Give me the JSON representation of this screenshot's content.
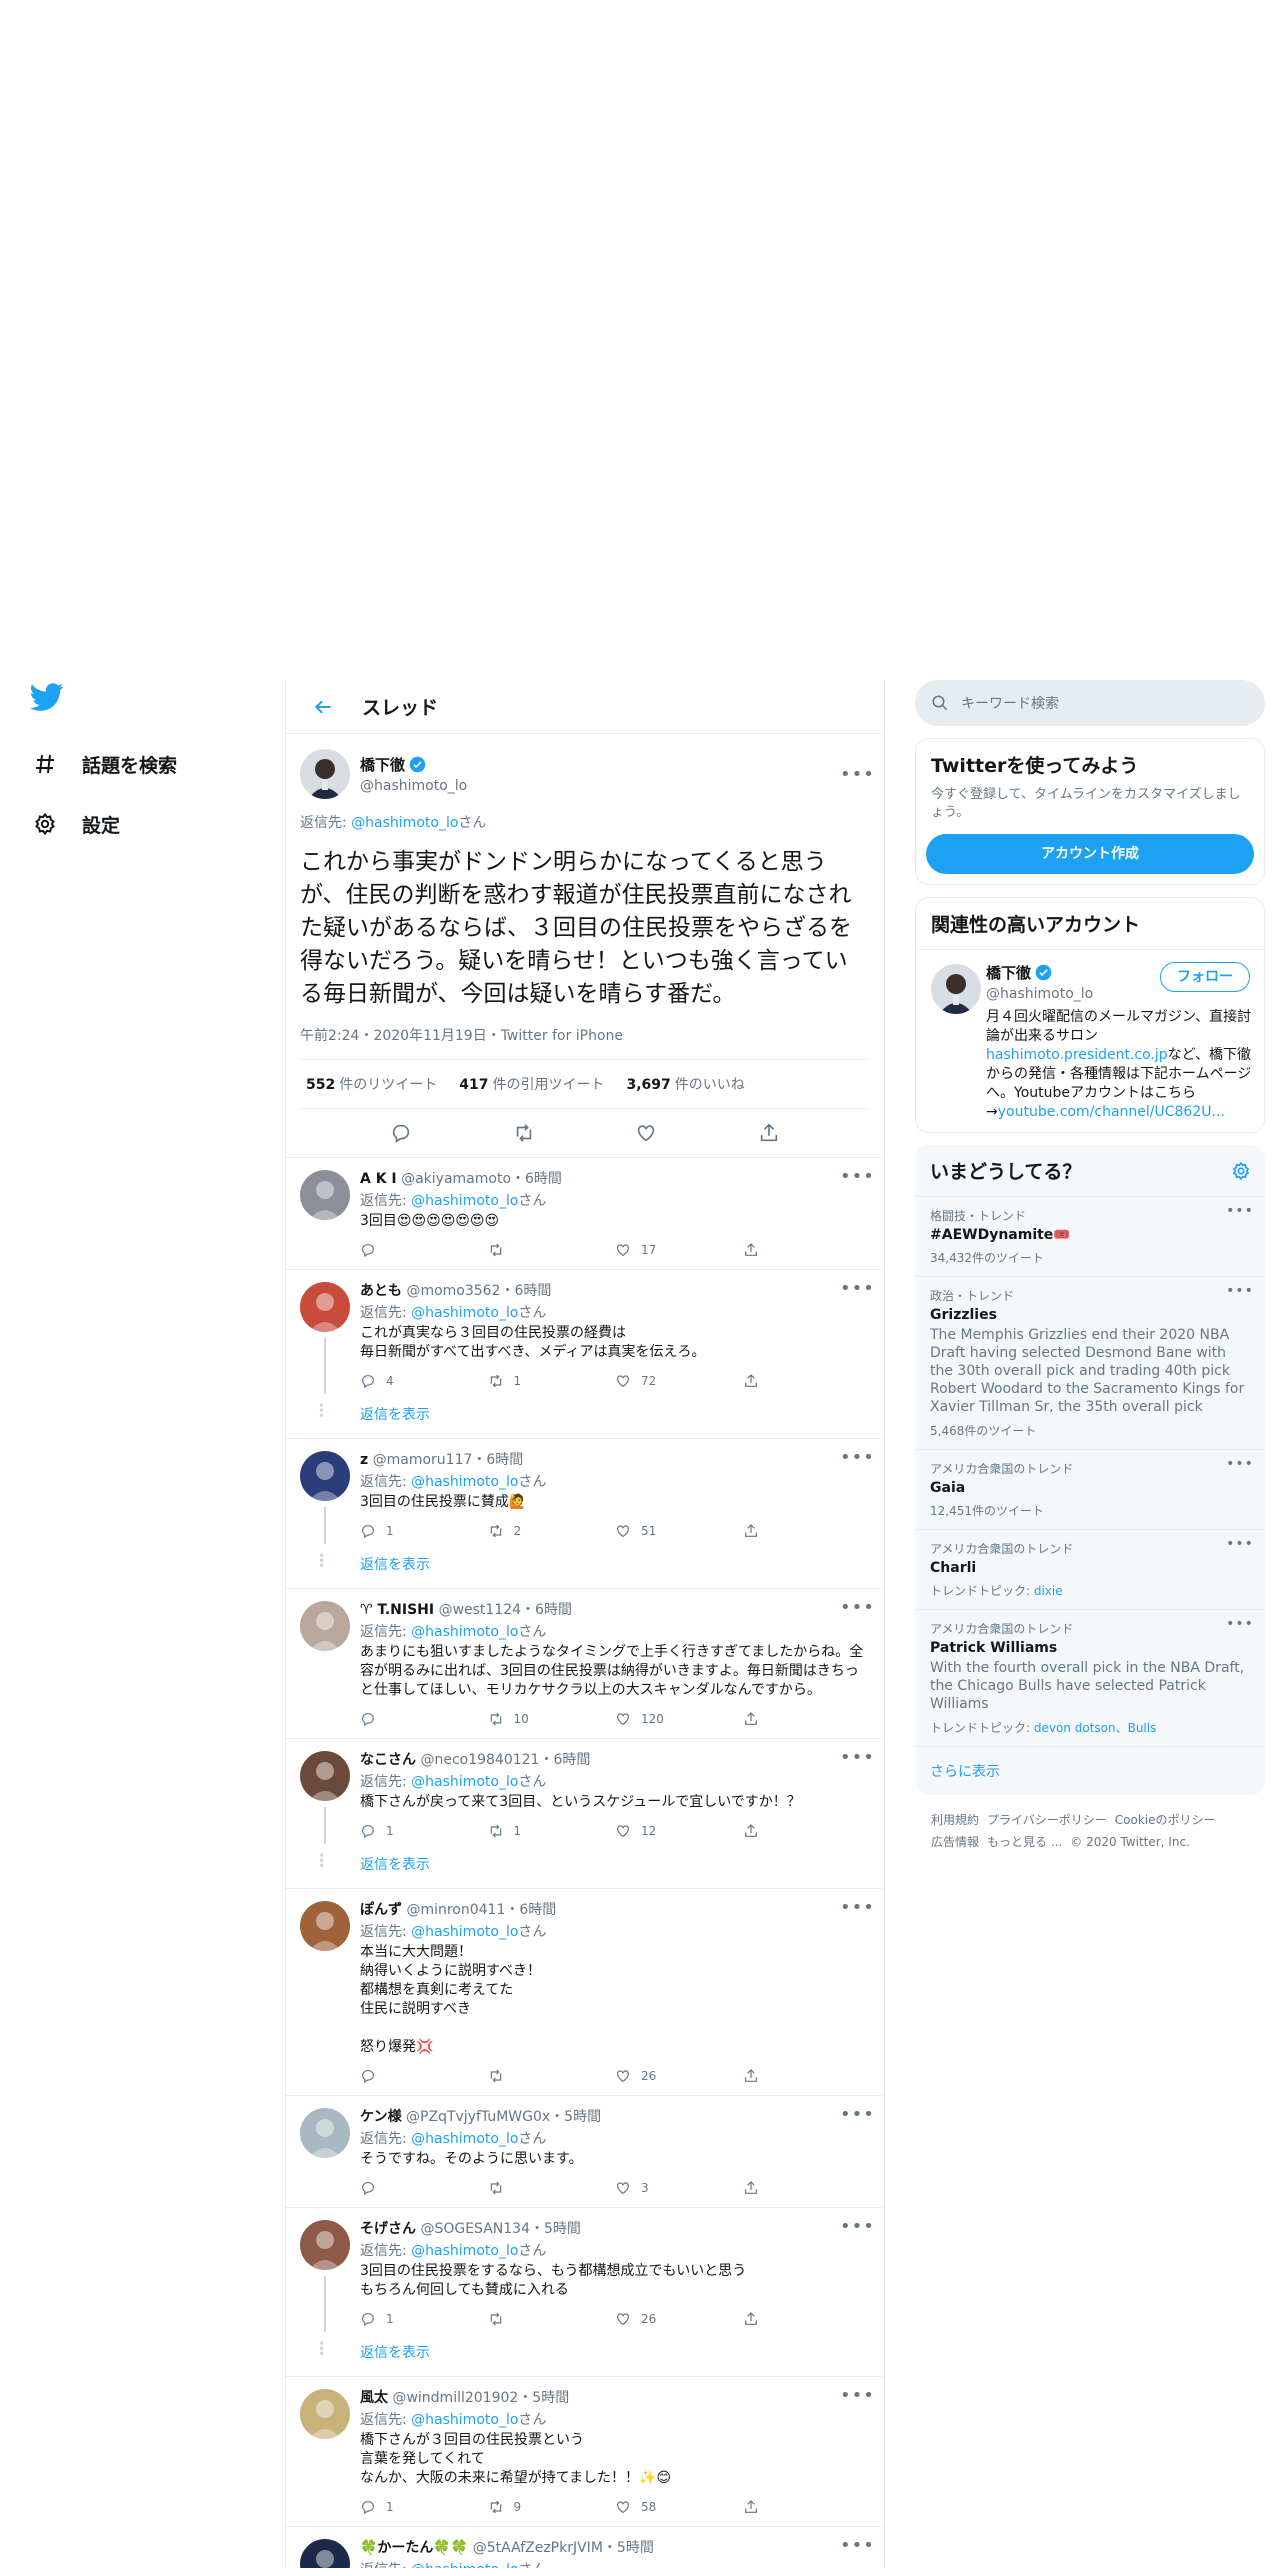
{
  "nav": {
    "items": [
      {
        "label": "話題を検索",
        "icon": "hashtag-icon"
      },
      {
        "label": "設定",
        "icon": "gear-icon"
      }
    ]
  },
  "header": {
    "title": "スレッド"
  },
  "focus": {
    "name": "橋下徹",
    "handle": "@hashimoto_lo",
    "reply_prefix": "返信先: ",
    "reply_to": "@hashimoto_lo",
    "reply_suffix": "さん",
    "text": "これから事実がドンドン明らかになってくると思うが、住民の判断を惑わす報道が住民投票直前になされた疑いがあるならば、３回目の住民投票をやらざるを得ないだろう。疑いを晴らせ！といつも強く言っている毎日新聞が、今回は疑いを晴らす番だ。",
    "meta": "午前2:24・2020年11月19日・Twitter for iPhone",
    "retweets": "552",
    "retweets_label": "件のリツイート",
    "quotes": "417",
    "quotes_label": "件の引用ツイート",
    "likes": "3,697",
    "likes_label": "件のいいね"
  },
  "replies": [
    {
      "name": "A K I",
      "handle": "@akiyamamoto",
      "time": "・6時間",
      "reply_to": "@hashimoto_lo",
      "text": "3回目😍😍😍😍😍😍😍",
      "replies": "",
      "retweets": "",
      "likes": "17",
      "show_replies": "",
      "avatar_color": "#8a8f99"
    },
    {
      "name": "あとも",
      "handle": "@momo3562",
      "time": "・6時間",
      "reply_to": "@hashimoto_lo",
      "text": "これが真実なら３回目の住民投票の経費は\n毎日新聞がすべて出すべき、メディアは真実を伝えろ。",
      "replies": "4",
      "retweets": "1",
      "likes": "72",
      "show_replies": "返信を表示",
      "avatar_color": "#c84b3c"
    },
    {
      "name": "z",
      "handle": "@mamoru117",
      "time": "・6時間",
      "reply_to": "@hashimoto_lo",
      "text": "3回目の住民投票に賛成🙋",
      "replies": "1",
      "retweets": "2",
      "likes": "51",
      "show_replies": "返信を表示",
      "avatar_color": "#2a3d7a"
    },
    {
      "name": "♈ T.NISHI",
      "handle": "@west1124",
      "time": "・6時間",
      "reply_to": "@hashimoto_lo",
      "text": "あまりにも狙いすましたようなタイミングで上手く行きすぎてましたからね。全容が明るみに出れば、3回目の住民投票は納得がいきますよ。毎日新聞はきちっと仕事してほしい、モリカケサクラ以上の大スキャンダルなんですから。",
      "replies": "",
      "retweets": "10",
      "likes": "120",
      "show_replies": "",
      "avatar_color": "#b8a79a"
    },
    {
      "name": "なこさん",
      "handle": "@neco19840121",
      "time": "・6時間",
      "reply_to": "@hashimoto_lo",
      "text": "橋下さんが戻って来て3回目、というスケジュールで宜しいですか！？",
      "replies": "1",
      "retweets": "1",
      "likes": "12",
      "show_replies": "返信を表示",
      "avatar_color": "#6b4a3a"
    },
    {
      "name": "ぽんず",
      "handle": "@minron0411",
      "time": "・6時間",
      "reply_to": "@hashimoto_lo",
      "text": "本当に大大問題！\n納得いくように説明すべき！\n都構想を真剣に考えてた\n住民に説明すべき\n\n怒り爆発💢",
      "replies": "",
      "retweets": "",
      "likes": "26",
      "show_replies": "",
      "avatar_color": "#a0623a"
    },
    {
      "name": "ケン様",
      "handle": "@PZqTvjyfTuMWG0x",
      "time": "・5時間",
      "reply_to": "@hashimoto_lo",
      "text": "そうですね。そのように思います。",
      "replies": "",
      "retweets": "",
      "likes": "3",
      "show_replies": "",
      "avatar_color": "#aab8c2"
    },
    {
      "name": "そげさん",
      "handle": "@SOGESAN134",
      "time": "・5時間",
      "reply_to": "@hashimoto_lo",
      "text": "3回目の住民投票をするなら、もう都構想成立でもいいと思う\nもちろん何回しても賛成に入れる",
      "replies": "1",
      "retweets": "",
      "likes": "26",
      "show_replies": "返信を表示",
      "avatar_color": "#8c5a46"
    },
    {
      "name": "風太",
      "handle": "@windmill201902",
      "time": "・5時間",
      "reply_to": "@hashimoto_lo",
      "text": "橋下さんが３回目の住民投票という\n言葉を発してくれて\nなんか、大阪の未来に希望が持てました！！✨😊",
      "replies": "1",
      "retweets": "9",
      "likes": "58",
      "show_replies": "",
      "avatar_color": "#c9b17a"
    },
    {
      "name": "🍀かーたん🍀🍀",
      "handle": "@5tAAfZezPkrJVIM",
      "time": "・5時間",
      "reply_to": "@hashimoto_lo",
      "text": "",
      "replies": "",
      "retweets": "",
      "likes": "",
      "show_replies": "",
      "avatar_color": "#1b2a4a"
    }
  ],
  "reply_prefix": "返信先: ",
  "reply_suffix": "さん",
  "search": {
    "placeholder": "キーワード検索"
  },
  "signup": {
    "title": "Twitterを使ってみよう",
    "desc": "今すぐ登録して、タイムラインをカスタマイズしましょう。",
    "button": "アカウント作成"
  },
  "related": {
    "title": "関連性の高いアカウント",
    "name": "橋下徹",
    "handle": "@hashimoto_lo",
    "follow": "フォロー",
    "bio_1": "月４回火曜配信のメールマガジン、直接討論が出来るサロン",
    "bio_link_1": "hashimoto.president.co.jp",
    "bio_2": "など、橋下徹からの発信・各種情報は下記ホームページへ。Youtubeアカウントはこちら→",
    "bio_link_2": "youtube.com/channel/UC862U..."
  },
  "trends": {
    "title": "いまどうしてる？",
    "items": [
      {
        "cat": "格闘技・トレンド",
        "title": "#AEWDynamite🎟️",
        "desc": "",
        "count": "34,432件のツイート",
        "topic_label": "",
        "topic": ""
      },
      {
        "cat": "政治・トレンド",
        "title": "Grizzlies",
        "desc": "The Memphis Grizzlies end their 2020 NBA Draft having selected Desmond Bane with the 30th overall pick and trading 40th pick Robert Woodard to the Sacramento Kings for Xavier Tillman Sr, the 35th overall pick",
        "count": "5,468件のツイート",
        "topic_label": "",
        "topic": ""
      },
      {
        "cat": "アメリカ合衆国のトレンド",
        "title": "Gaia",
        "desc": "",
        "count": "12,451件のツイート",
        "topic_label": "",
        "topic": ""
      },
      {
        "cat": "アメリカ合衆国のトレンド",
        "title": "Charli",
        "desc": "",
        "count": "",
        "topic_label": "トレンドトピック: ",
        "topic": "dixie"
      },
      {
        "cat": "アメリカ合衆国のトレンド",
        "title": "Patrick Williams",
        "desc": "With the fourth overall pick in the NBA Draft, the Chicago Bulls have selected Patrick Williams",
        "count": "",
        "topic_label": "トレンドトピック: ",
        "topic": "devon dotson、Bulls"
      }
    ],
    "show_more": "さらに表示"
  },
  "footer": {
    "links": [
      "利用規約",
      "プライバシーポリシー",
      "Cookieのポリシー",
      "広告情報",
      "もっと見る ...",
      "© 2020 Twitter, Inc."
    ]
  },
  "colors": {
    "accent": "#1da1f2",
    "muted": "#657786",
    "border": "#e6ecf0"
  }
}
